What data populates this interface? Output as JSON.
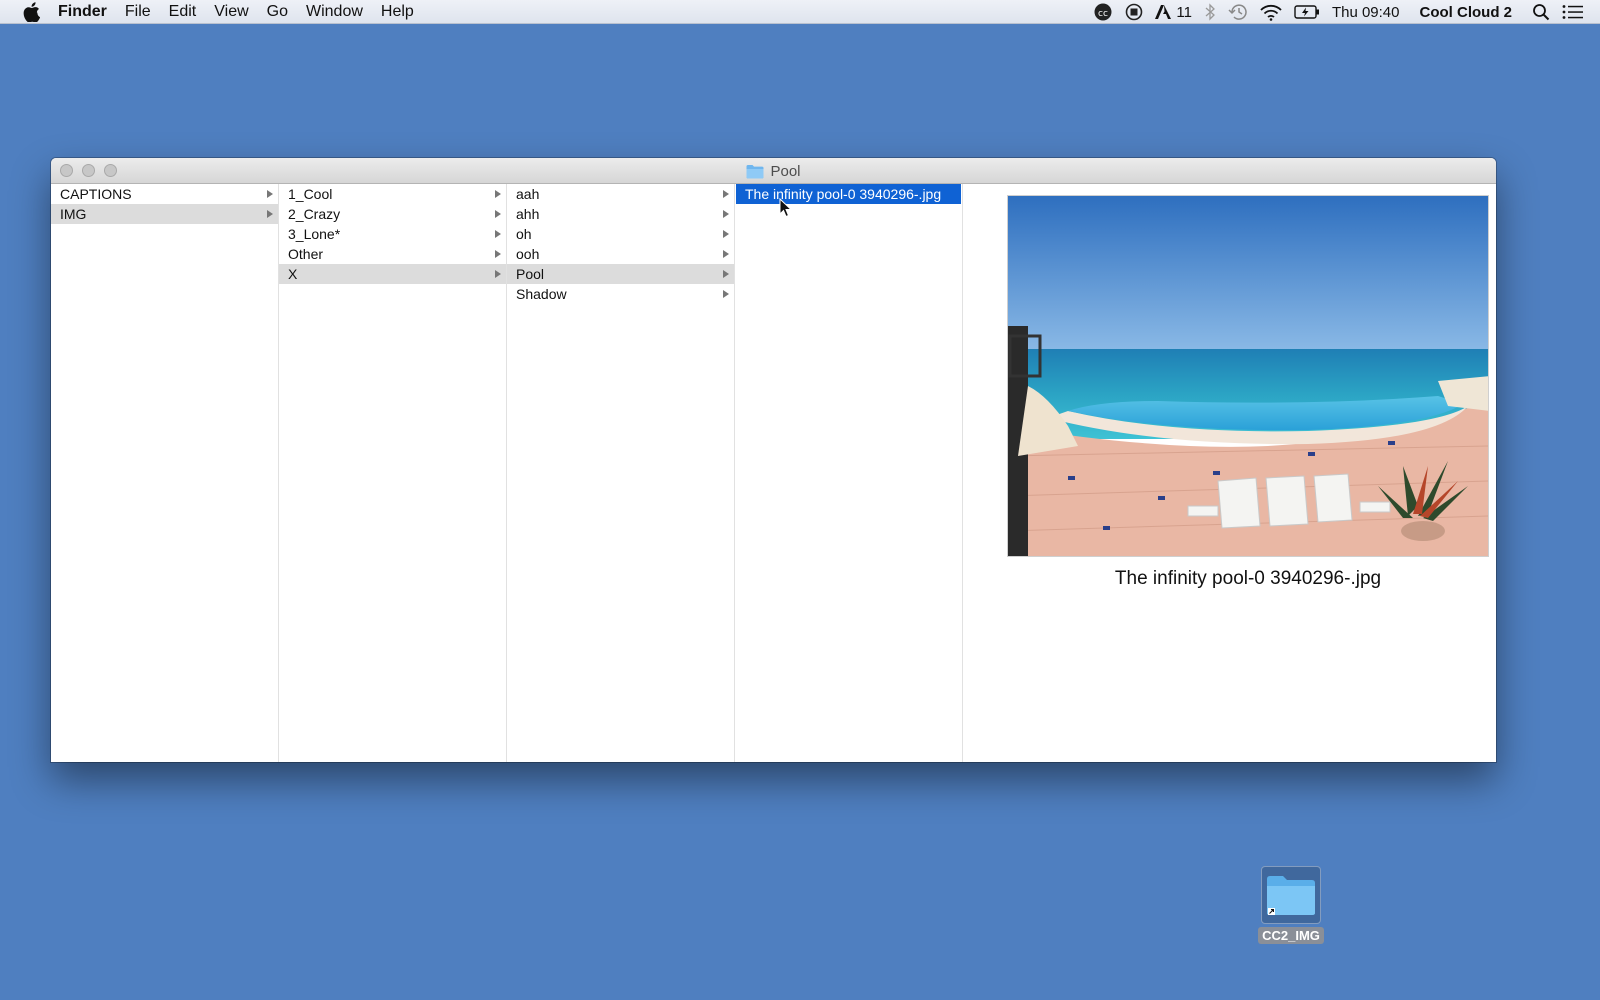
{
  "menubar": {
    "app_name": "Finder",
    "menus": [
      "File",
      "Edit",
      "View",
      "Go",
      "Window",
      "Help"
    ],
    "status": {
      "adobe_count": "11",
      "clock": "Thu 09:40",
      "user": "Cool Cloud 2"
    }
  },
  "window": {
    "title": "Pool",
    "columns": [
      {
        "items": [
          {
            "label": "CAPTIONS",
            "arrow": true,
            "state": "none"
          },
          {
            "label": "IMG",
            "arrow": true,
            "state": "path"
          }
        ]
      },
      {
        "items": [
          {
            "label": "1_Cool",
            "arrow": true,
            "state": "none"
          },
          {
            "label": "2_Crazy",
            "arrow": true,
            "state": "none"
          },
          {
            "label": "3_Lone*",
            "arrow": true,
            "state": "none"
          },
          {
            "label": "Other",
            "arrow": true,
            "state": "none"
          },
          {
            "label": "X",
            "arrow": true,
            "state": "path"
          }
        ]
      },
      {
        "items": [
          {
            "label": "aah",
            "arrow": true,
            "state": "none"
          },
          {
            "label": "ahh",
            "arrow": true,
            "state": "none"
          },
          {
            "label": "oh",
            "arrow": true,
            "state": "none"
          },
          {
            "label": "ooh",
            "arrow": true,
            "state": "none"
          },
          {
            "label": "Pool",
            "arrow": true,
            "state": "path"
          },
          {
            "label": "Shadow",
            "arrow": true,
            "state": "none"
          }
        ]
      },
      {
        "items": [
          {
            "label": "The infinity pool-0 3940296-.jpg",
            "arrow": false,
            "state": "selected"
          }
        ]
      }
    ],
    "preview": {
      "file_name": "The infinity pool-0 3940296-.jpg"
    }
  },
  "desktop": {
    "icons": [
      {
        "label": "CC2_IMG",
        "icon": "folder-alias-icon"
      }
    ]
  },
  "colors": {
    "desktop": "#4f7fc0",
    "selection": "#0f62d4",
    "path_highlight": "#dcdcdc"
  }
}
